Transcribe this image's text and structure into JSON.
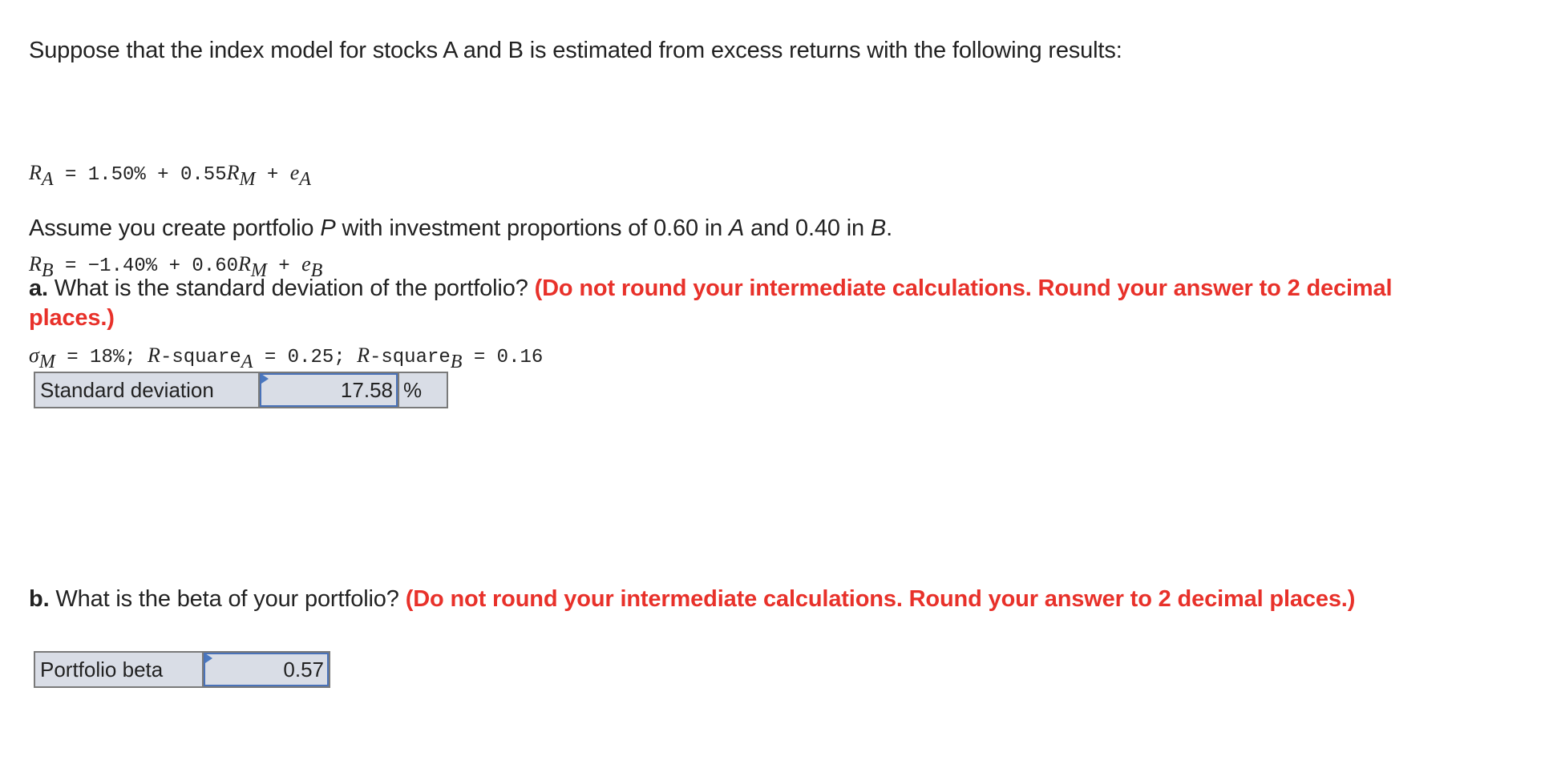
{
  "problem": {
    "intro": "Suppose that the index model for stocks A and B is estimated from excess returns with the following results:",
    "equations": [
      {
        "lhs_var": "R",
        "lhs_sub": "A",
        "body_1": " = 1.50% + 0.55",
        "mid_var": "R",
        "mid_sub": "M",
        "body_2": " + ",
        "end_var": "e",
        "end_sub": "A"
      },
      {
        "lhs_var": "R",
        "lhs_sub": "B",
        "body_1": " = −1.40% + 0.60",
        "mid_var": "R",
        "mid_sub": "M",
        "body_2": " + ",
        "end_var": "e",
        "end_sub": "B"
      }
    ],
    "stats_line": {
      "sigma_var": "σ",
      "sigma_sub": "M",
      "part_1": " = 18%; ",
      "rsq_a_var": "R",
      "rsq_a_text": "-square",
      "rsq_a_sub": "A",
      "part_2": " = 0.25; ",
      "rsq_b_var": "R",
      "rsq_b_text": "-square",
      "rsq_b_sub": "B",
      "part_3": " = 0.16"
    },
    "assume": {
      "pre": "Assume you create portfolio ",
      "portfolio_var": "P",
      "mid": " with investment proportions of 0.60 in ",
      "stock_a": "A",
      "and": " and 0.40 in ",
      "stock_b": "B",
      "end": "."
    }
  },
  "question_a": {
    "label": "a.",
    "text": " What is the standard deviation of the portfolio? ",
    "instruction_line1": "(Do not round your intermediate calculations. Round your answer to 2 decimal",
    "instruction_line2": "places.)",
    "answer": {
      "row_label": "Standard deviation",
      "value": "17.58",
      "unit": "%"
    }
  },
  "question_b": {
    "label": "b.",
    "text": " What is the beta of your portfolio? ",
    "instruction": "(Do not round your intermediate calculations. Round your answer to 2 decimal places.)",
    "answer": {
      "row_label": "Portfolio beta",
      "value": "0.57"
    }
  },
  "colors": {
    "instruction_red": "#e8312a",
    "input_border_blue": "#4a72b8",
    "cell_background": "#d9dde6"
  }
}
